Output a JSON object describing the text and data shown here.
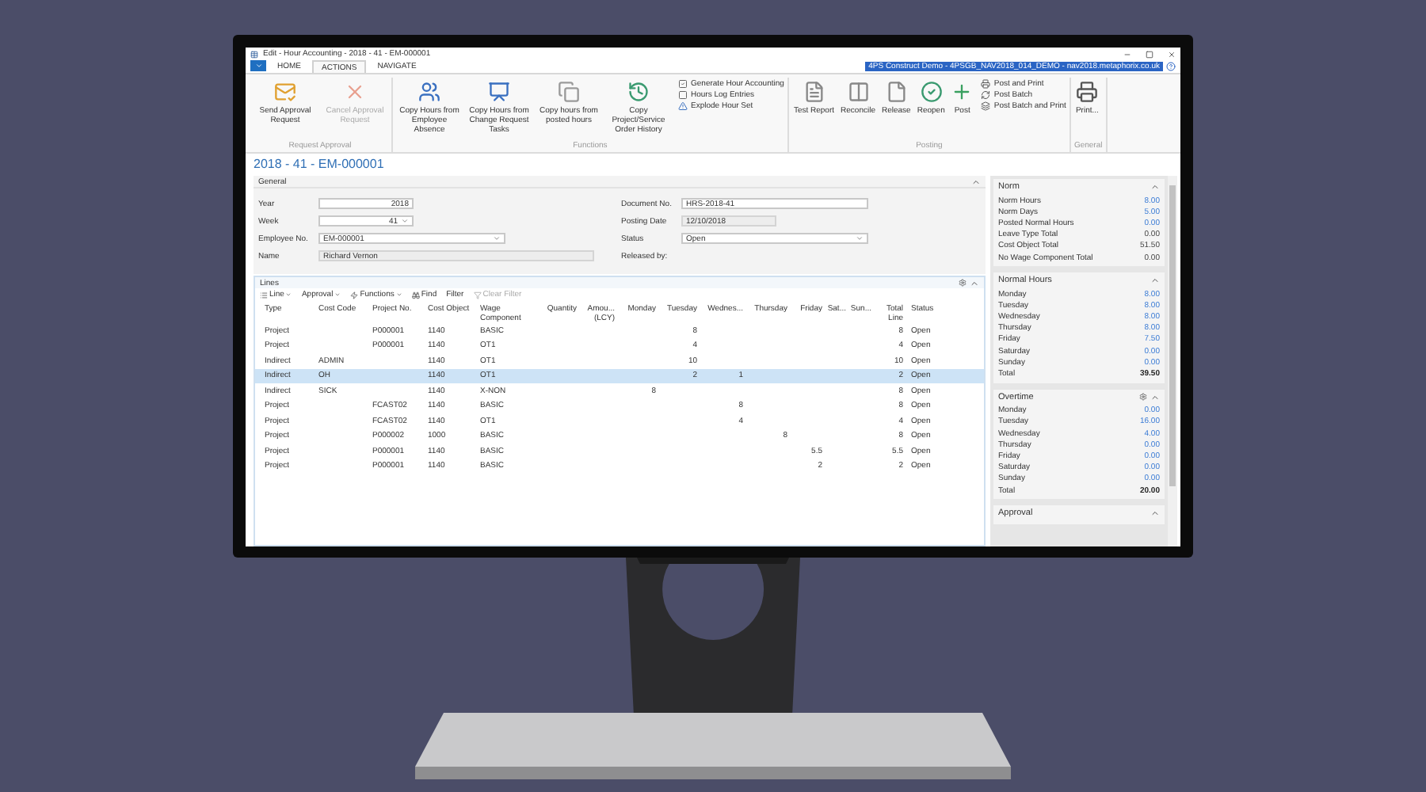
{
  "window": {
    "title": "Edit - Hour Accounting - 2018 - 41 - EM-000001"
  },
  "ribbon_tabs": [
    {
      "label": "HOME",
      "selected": false
    },
    {
      "label": "ACTIONS",
      "selected": true
    },
    {
      "label": "NAVIGATE",
      "selected": false
    }
  ],
  "connection": "4PS Construct Demo - 4PSGB_NAV2018_014_DEMO - nav2018.metaphorix.co.uk",
  "ribbon_groups": [
    {
      "title": "Request Approval",
      "items": [
        {
          "kind": "large",
          "label": "Send Approval Request",
          "disabled": false
        },
        {
          "kind": "large",
          "label": "Cancel Approval Request",
          "disabled": true
        }
      ]
    },
    {
      "title": "Functions",
      "items": [
        {
          "kind": "large",
          "label": "Copy Hours from Employee Absence",
          "disabled": false
        },
        {
          "kind": "large",
          "label": "Copy Hours from Change Request Tasks",
          "disabled": false
        },
        {
          "kind": "large",
          "label": "Copy hours from posted hours",
          "disabled": false
        },
        {
          "kind": "large",
          "label": "Copy Project/Service Order History",
          "disabled": false
        },
        {
          "kind": "small",
          "label": "Generate Hour Accounting",
          "disabled": false
        },
        {
          "kind": "small",
          "label": "Hours Log Entries",
          "disabled": false
        },
        {
          "kind": "small",
          "label": "Explode Hour Set",
          "disabled": false
        }
      ]
    },
    {
      "title": "Posting",
      "items": [
        {
          "kind": "large",
          "label": "Test Report",
          "disabled": false
        },
        {
          "kind": "large",
          "label": "Reconcile",
          "disabled": false
        },
        {
          "kind": "large",
          "label": "Release",
          "disabled": false
        },
        {
          "kind": "large",
          "label": "Reopen",
          "disabled": false
        },
        {
          "kind": "large",
          "label": "Post",
          "disabled": false
        },
        {
          "kind": "small",
          "label": "Post and Print",
          "disabled": false
        },
        {
          "kind": "small",
          "label": "Post Batch",
          "disabled": false
        },
        {
          "kind": "small",
          "label": "Post Batch and Print",
          "disabled": false
        }
      ]
    },
    {
      "title": "General",
      "items": [
        {
          "kind": "large",
          "label": "Print...",
          "disabled": false
        }
      ]
    }
  ],
  "page_title": "2018 - 41 - EM-000001",
  "general": {
    "title": "General",
    "expanded": true,
    "left_fields": [
      {
        "label": "Year",
        "kind": "number",
        "value": "2018"
      },
      {
        "label": "Week",
        "kind": "number_dropdown",
        "value": "41"
      },
      {
        "label": "Employee No.",
        "kind": "dropdown",
        "value": "EM-000001"
      },
      {
        "label": "Name",
        "kind": "readonly",
        "value": "Richard Vernon"
      }
    ],
    "right_fields": [
      {
        "label": "Document No.",
        "kind": "text",
        "value": "HRS-2018-41"
      },
      {
        "label": "Posting Date",
        "kind": "readonly",
        "value": "12/10/2018"
      },
      {
        "label": "Status",
        "kind": "dropdown",
        "value": "Open"
      },
      {
        "label": "Released by:",
        "kind": "label"
      }
    ]
  },
  "lines": {
    "title": "Lines",
    "expanded": true,
    "toolbar": [
      {
        "label": "Line",
        "menu": true,
        "disabled": false
      },
      {
        "label": "Approval",
        "menu": true,
        "disabled": false
      },
      {
        "label": "Functions",
        "menu": true,
        "disabled": false
      },
      {
        "label": "Find",
        "menu": false,
        "disabled": false
      },
      {
        "label": "Filter",
        "menu": false,
        "disabled": false
      },
      {
        "label": "Clear Filter",
        "menu": false,
        "disabled": true
      }
    ],
    "columns": [
      "Type",
      "Cost Code",
      "Project No.",
      "Cost Object",
      "Wage Component",
      "Quantity",
      "Amou... (LCY)",
      "Monday",
      "Tuesday",
      "Wednes...",
      "Thursday",
      "Friday",
      "Sat...",
      "Sun...",
      "Total Line",
      "Status"
    ],
    "rows": [
      {
        "selected": false,
        "cells": [
          "Project",
          null,
          "P000001",
          "1140",
          "BASIC",
          null,
          null,
          null,
          "8",
          null,
          null,
          null,
          null,
          null,
          "8",
          "Open"
        ]
      },
      {
        "selected": false,
        "cells": [
          "Project",
          null,
          "P000001",
          "1140",
          "OT1",
          null,
          null,
          null,
          "4",
          null,
          null,
          null,
          null,
          null,
          "4",
          "Open"
        ]
      },
      {
        "selected": false,
        "cells": [
          "Indirect",
          "ADMIN",
          null,
          "1140",
          "OT1",
          null,
          null,
          null,
          "10",
          null,
          null,
          null,
          null,
          null,
          "10",
          "Open"
        ]
      },
      {
        "selected": true,
        "cells": [
          "Indirect",
          "OH",
          null,
          "1140",
          "OT1",
          null,
          null,
          null,
          "2",
          "1",
          null,
          null,
          null,
          null,
          "2",
          "Open"
        ]
      },
      {
        "selected": false,
        "cells": [
          "Indirect",
          "SICK",
          null,
          "1140",
          "X-NON",
          null,
          null,
          "8",
          null,
          null,
          null,
          null,
          null,
          null,
          "8",
          "Open"
        ]
      },
      {
        "selected": false,
        "cells": [
          "Project",
          null,
          "FCAST02",
          "1140",
          "BASIC",
          null,
          null,
          null,
          null,
          "8",
          null,
          null,
          null,
          null,
          "8",
          "Open"
        ]
      },
      {
        "selected": false,
        "cells": [
          "Project",
          null,
          "FCAST02",
          "1140",
          "OT1",
          null,
          null,
          null,
          null,
          "4",
          null,
          null,
          null,
          null,
          "4",
          "Open"
        ]
      },
      {
        "selected": false,
        "cells": [
          "Project",
          null,
          "P000002",
          "1000",
          "BASIC",
          null,
          null,
          null,
          null,
          null,
          "8",
          null,
          null,
          null,
          "8",
          "Open"
        ]
      },
      {
        "selected": false,
        "cells": [
          "Project",
          null,
          "P000001",
          "1140",
          "BASIC",
          null,
          null,
          null,
          null,
          null,
          null,
          "5.5",
          null,
          null,
          "5.5",
          "Open"
        ]
      },
      {
        "selected": false,
        "cells": [
          "Project",
          null,
          "P000001",
          "1140",
          "BASIC",
          null,
          null,
          null,
          null,
          null,
          null,
          "2",
          null,
          null,
          "2",
          "Open"
        ]
      }
    ]
  },
  "factbox": [
    {
      "title": "Norm",
      "settings": false,
      "expanded": true,
      "rows": [
        {
          "label": "Norm Hours",
          "value": "8.00",
          "kind": "link"
        },
        {
          "label": "Norm Days",
          "value": "5.00",
          "kind": "link"
        },
        {
          "label": "Posted Normal Hours",
          "value": "0.00",
          "kind": "link"
        },
        {
          "label": "Leave Type Total",
          "value": "0.00",
          "kind": "plain"
        },
        {
          "label": "Cost Object Total",
          "value": "51.50",
          "kind": "plain"
        },
        {
          "label": "No Wage Component Total",
          "value": "0.00",
          "kind": "plain"
        }
      ]
    },
    {
      "title": "Normal Hours",
      "settings": false,
      "expanded": true,
      "rows": [
        {
          "label": "Monday",
          "value": "8.00",
          "kind": "link"
        },
        {
          "label": "Tuesday",
          "value": "8.00",
          "kind": "link"
        },
        {
          "label": "Wednesday",
          "value": "8.00",
          "kind": "link"
        },
        {
          "label": "Thursday",
          "value": "8.00",
          "kind": "link"
        },
        {
          "label": "Friday",
          "value": "7.50",
          "kind": "link"
        },
        {
          "label": "Saturday",
          "value": "0.00",
          "kind": "link"
        },
        {
          "label": "Sunday",
          "value": "0.00",
          "kind": "link"
        },
        {
          "label": "Total",
          "value": "39.50",
          "kind": "total"
        }
      ]
    },
    {
      "title": "Overtime",
      "settings": true,
      "expanded": true,
      "rows": [
        {
          "label": "Monday",
          "value": "0.00",
          "kind": "link"
        },
        {
          "label": "Tuesday",
          "value": "16.00",
          "kind": "link"
        },
        {
          "label": "Wednesday",
          "value": "4.00",
          "kind": "link"
        },
        {
          "label": "Thursday",
          "value": "0.00",
          "kind": "link"
        },
        {
          "label": "Friday",
          "value": "0.00",
          "kind": "link"
        },
        {
          "label": "Saturday",
          "value": "0.00",
          "kind": "link"
        },
        {
          "label": "Sunday",
          "value": "0.00",
          "kind": "link"
        },
        {
          "label": "Total",
          "value": "20.00",
          "kind": "total"
        }
      ]
    },
    {
      "title": "Approval",
      "settings": false,
      "expanded": true
    }
  ]
}
